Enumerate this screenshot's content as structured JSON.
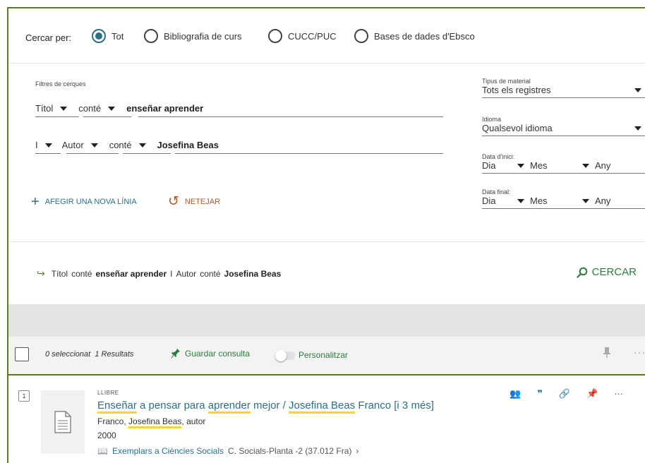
{
  "search_by": {
    "label": "Cercar per:",
    "options": [
      {
        "label": "Tot",
        "selected": true
      },
      {
        "label": "Bibliografia de curs",
        "selected": false
      },
      {
        "label": "CUCC/PUC",
        "selected": false
      },
      {
        "label": "Bases de dades d'Ebsco",
        "selected": false
      }
    ]
  },
  "filters": {
    "heading": "Filtres de cerques",
    "line1": {
      "field": "Títol",
      "operator": "conté",
      "value": "enseñar aprender"
    },
    "line2": {
      "boolean": "I",
      "field": "Autor",
      "operator": "conté",
      "value": "Josefina Beas"
    },
    "add_line": "AFEGIR UNA NOVA LÍNIA",
    "reset": "NETEJAR"
  },
  "right_filters": {
    "material": {
      "label": "Tipus de material",
      "value": "Tots els registres"
    },
    "language": {
      "label": "Idioma",
      "value": "Qualsevol idioma"
    },
    "start_date": {
      "label": "Data d'inici:",
      "day": "Dia",
      "month": "Mes",
      "year": "Any"
    },
    "end_date": {
      "label": "Data final:",
      "day": "Dia",
      "month": "Mes",
      "year": "Any"
    }
  },
  "summary": {
    "field1": "Títol",
    "op1": "conté",
    "val1": "enseñar aprender",
    "bool": "I",
    "field2": "Autor",
    "op2": "conté",
    "val2": "Josefina Beas",
    "search_button": "CERCAR"
  },
  "results_bar": {
    "selected": "0 seleccionat",
    "count": "1 Resultats",
    "save_query": "Guardar consulta",
    "personalize": "Personalitzar"
  },
  "result": {
    "index": "1",
    "type": "LLIBRE",
    "title_parts": [
      "Enseñar",
      " a pensar para ",
      "aprender",
      " mejor / ",
      "Josefina Beas",
      " Franco [i 3 més]"
    ],
    "author_prefix": "Franco, ",
    "author_highlight": "Josefina Beas",
    "author_suffix": ", autor",
    "year": "2000",
    "availability_label": "Exemplars a Ciències Socials",
    "availability_location": "C. Socials-Planta -2 (37.012 Fra)"
  },
  "colors": {
    "accent_green": "#2a7d3a",
    "link_blue": "#2a6f8a",
    "reset_orange": "#c0561f",
    "highlight_yellow": "#f5d53b"
  }
}
